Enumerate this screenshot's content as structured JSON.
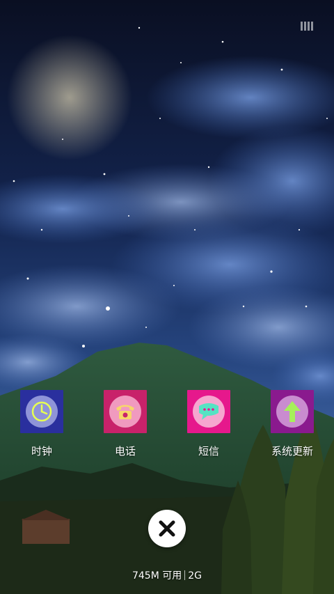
{
  "apps": [
    {
      "label": "时钟",
      "icon": "clock-icon",
      "bg": "#2a2f9e",
      "ring": "#8f94d8",
      "fg": "#e6ff52"
    },
    {
      "label": "电话",
      "icon": "phone-icon",
      "bg": "#c8226a",
      "ring": "#f09abf",
      "fg": "#f7d76a"
    },
    {
      "label": "短信",
      "icon": "message-icon",
      "bg": "#e6188c",
      "ring": "#f6a6cf",
      "fg": "#55e3c3"
    },
    {
      "label": "系统更新",
      "icon": "update-icon",
      "bg": "#8a1a8e",
      "ring": "#c98ccf",
      "fg": "#a6f05a"
    }
  ],
  "close": {
    "icon": "close-icon"
  },
  "memory": {
    "available": "745M 可用",
    "network": "2G"
  }
}
